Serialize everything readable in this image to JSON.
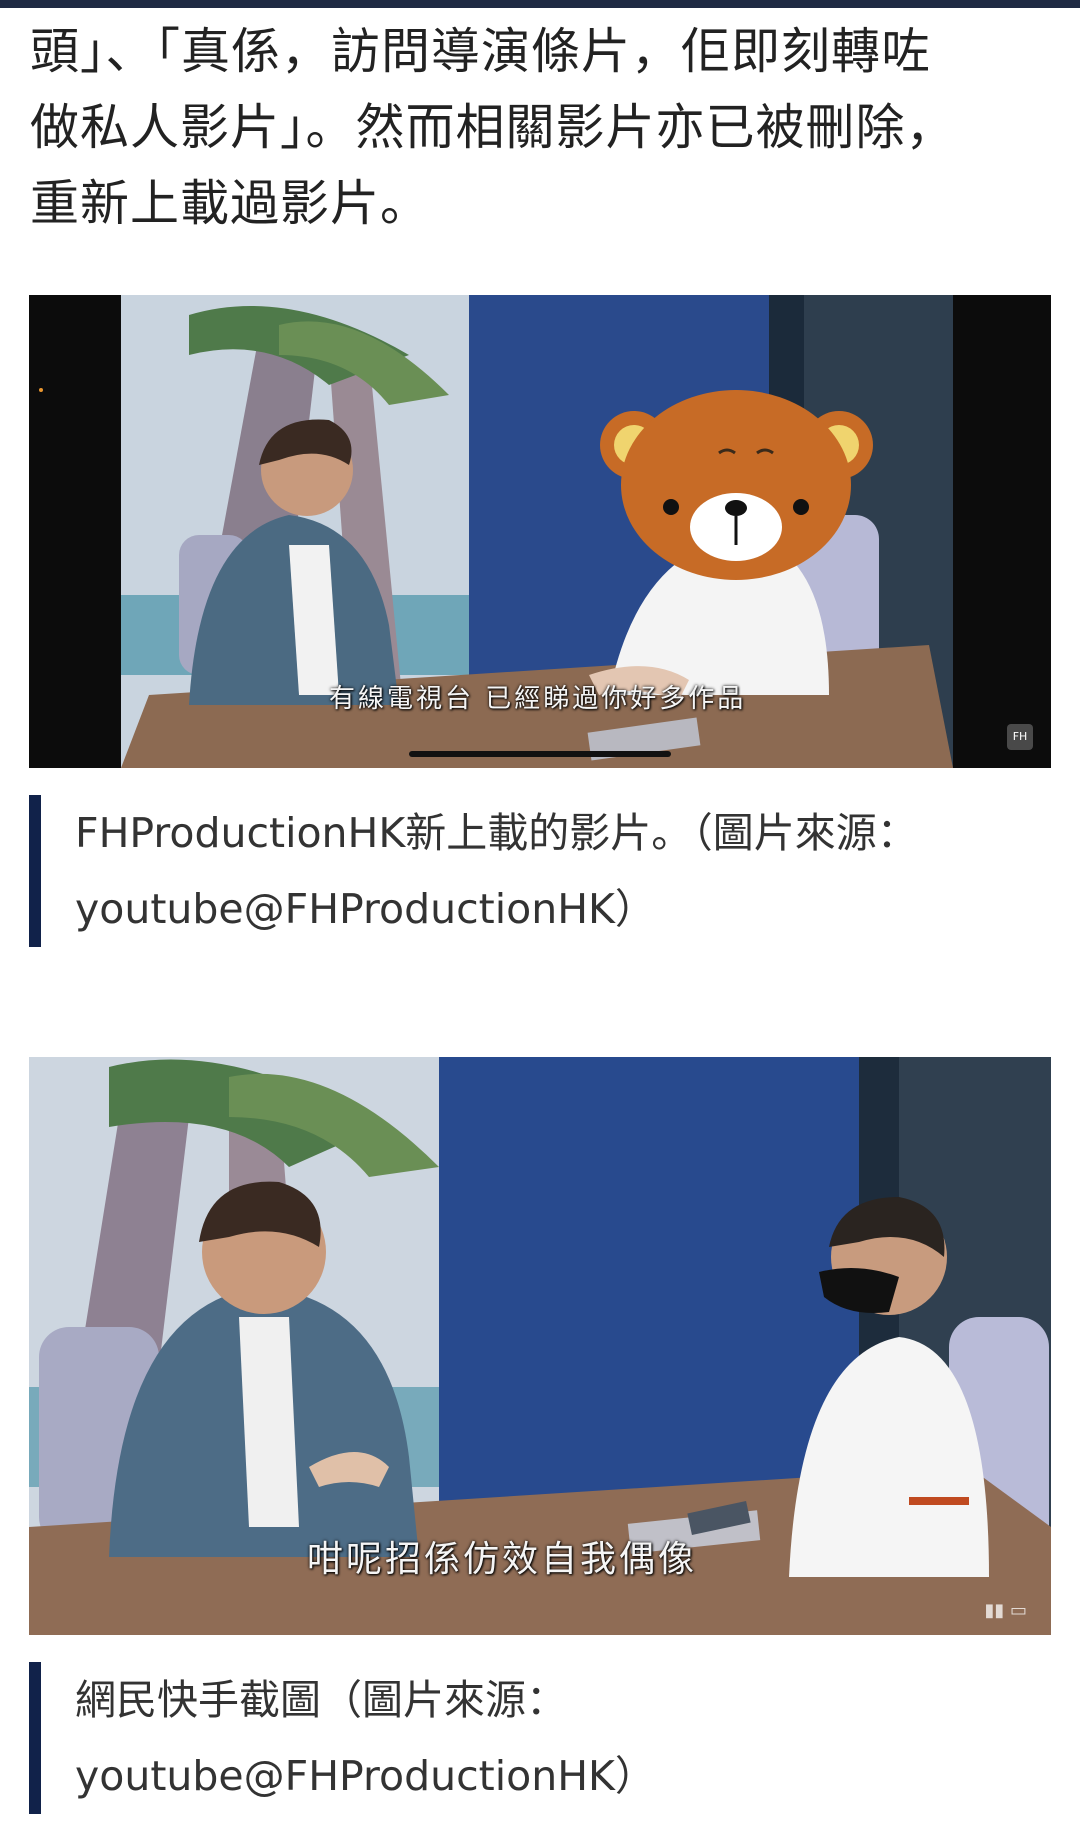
{
  "article": {
    "paragraph_lines": [
      "頭」、「真係，訪問導演條片，佢即刻轉咗",
      "做私人影片」。然而相關影片亦已被刪除，",
      "重新上載過影片。"
    ]
  },
  "figures": [
    {
      "subtitle": "有線電視台 已經睇過你好多作品",
      "caption_lines": [
        "FHProductionHK新上載的影片。（圖片來源：",
        "youtube@FHProductionHK）"
      ]
    },
    {
      "subtitle": "咁呢招係仿效自我偶像",
      "caption_lines": [
        "網民快手截圖（圖片來源：",
        "youtube@FHProductionHK）"
      ]
    }
  ],
  "colors": {
    "top_bar": "#1f2a44",
    "caption_rule": "#11224a",
    "body_text": "#222222",
    "caption_text": "#333333"
  },
  "icons": {
    "bear_mask": "bear-face-icon",
    "channel_logo": "fh-logo-icon",
    "player_controls": "player-controls-icon"
  }
}
